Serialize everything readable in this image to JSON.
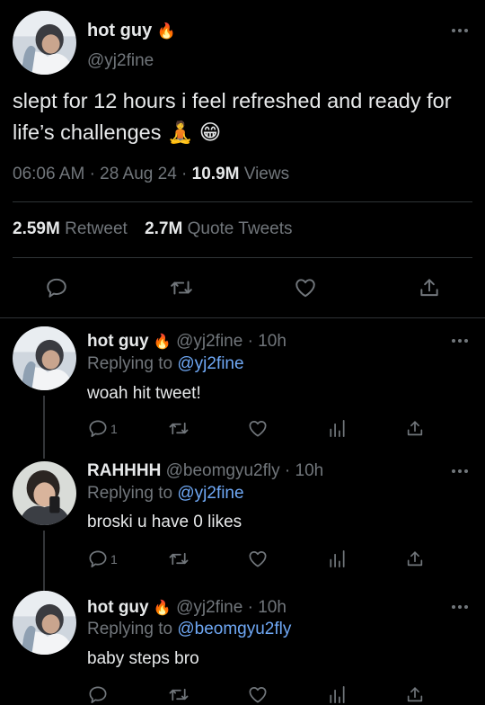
{
  "main_tweet": {
    "display_name": "hot guy",
    "handle": "@yj2fine",
    "text": "slept for 12 hours i feel refreshed and ready for life’s challenges 🧘 😁",
    "time": "06:06 AM",
    "date": "28 Aug 24",
    "views_count": "10.9M",
    "views_label": "Views",
    "retweets_count": "2.59M",
    "retweets_label": "Retweet",
    "quotes_count": "2.7M",
    "quotes_label": "Quote Tweets"
  },
  "fire_emoji": "🔥",
  "separator": "·",
  "replying_label": "Replying to",
  "replies": [
    {
      "display_name": "hot guy",
      "handle": "@yj2fine",
      "time": "10h",
      "replying_to": "@yj2fine",
      "text": "woah hit tweet!",
      "reply_count": "1"
    },
    {
      "display_name": "RAHHHH",
      "handle": "@beomgyu2fly",
      "time": "10h",
      "replying_to": "@yj2fine",
      "text": "broski u have 0 likes",
      "reply_count": "1"
    },
    {
      "display_name": "hot guy",
      "handle": "@yj2fine",
      "time": "10h",
      "replying_to": "@beomgyu2fly",
      "text": "baby steps bro",
      "reply_count": ""
    }
  ],
  "colors": {
    "background": "#000000",
    "text": "#e7e9ea",
    "muted": "#71767b",
    "link": "#6fa8f5",
    "divider": "#2f3336"
  },
  "icons": {
    "reply": "reply-icon",
    "retweet": "retweet-icon",
    "like": "heart-icon",
    "analytics": "analytics-icon",
    "share": "share-icon",
    "more": "more-icon"
  }
}
